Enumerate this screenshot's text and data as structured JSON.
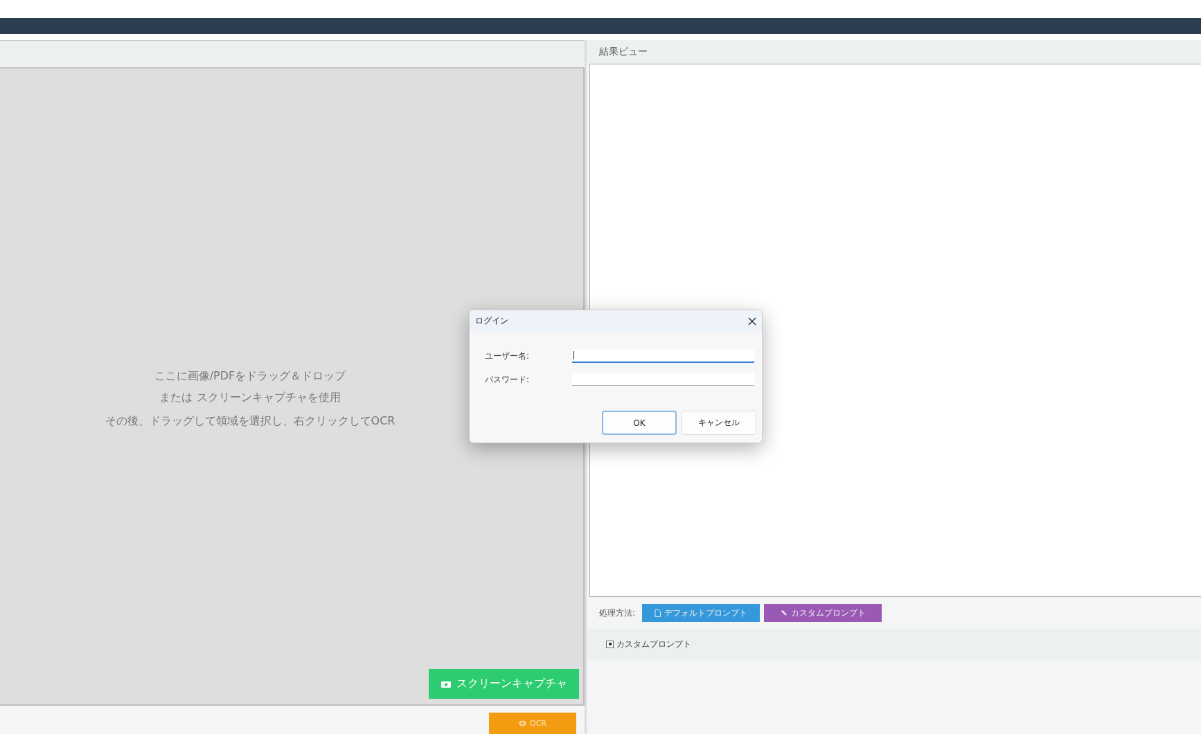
{
  "drop_area": {
    "lines": [
      "ここに画像/PDFをドラッグ＆ドロップ",
      "または スクリーンキャプチャを使用"
    ],
    "hint": "その後、ドラッグして領域を選択し、右クリックしてOCR"
  },
  "capture_button": {
    "label": "スクリーンキャプチャ"
  },
  "ocr_button": {
    "label": "OCR"
  },
  "result_view": {
    "title": "結果ビュー"
  },
  "method": {
    "label": "処理方法:",
    "buttons": [
      {
        "kind": "default",
        "label": "デフォルトプロンプト",
        "color": "#3498db"
      },
      {
        "kind": "custom",
        "label": "カスタムプロンプト",
        "color": "#9b59b6"
      }
    ]
  },
  "custom_prompt": {
    "label": "カスタムプロンプト",
    "checked": true
  },
  "dialog": {
    "title": "ログイン",
    "fields": [
      {
        "label": "ユーザー名:",
        "focused": true
      },
      {
        "label": "パスワード:",
        "focused": false
      }
    ],
    "buttons": [
      {
        "label": "OK",
        "selected": true
      },
      {
        "label": "キャンセル",
        "selected": false
      }
    ]
  }
}
